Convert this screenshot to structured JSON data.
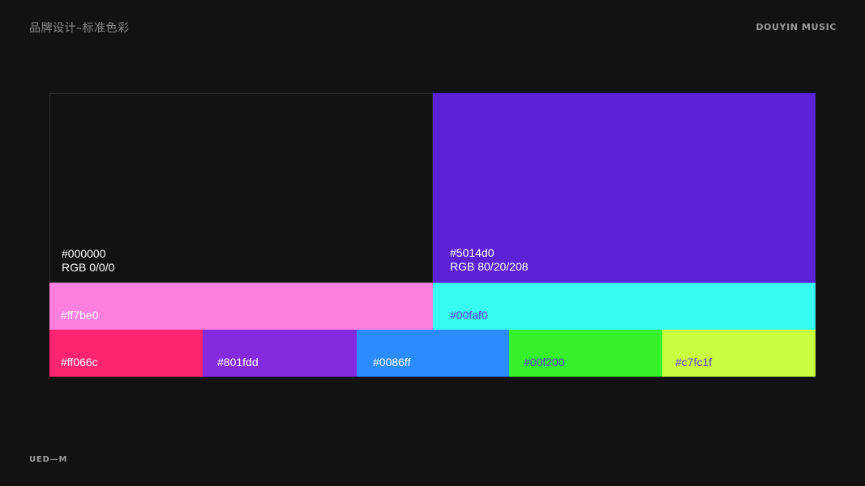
{
  "header": {
    "title": "品牌设计–标准色彩",
    "brand": "DOUYIN MUSIC"
  },
  "footer": {
    "mark": "UED—M"
  },
  "palette": {
    "primary": [
      {
        "hex_label": "#000000",
        "rgb_label": "RGB 0/0/0",
        "color": "#121212",
        "text_color": "#ffffff"
      },
      {
        "hex_label": "#5014d0",
        "rgb_label": "RGB 80/20/208",
        "color": "#5b22d6",
        "text_color": "#ffffff"
      }
    ],
    "secondary": [
      {
        "hex_label": "#ff7be0",
        "color": "#ff7fde",
        "text_color": "#ffffff"
      },
      {
        "hex_label": "#00faf0",
        "color": "#37fbf0",
        "text_color": "#5a3ad8"
      }
    ],
    "accents": [
      {
        "hex_label": "#ff066c",
        "color": "#ff2470",
        "text_color": "#ffffff"
      },
      {
        "hex_label": "#801fdd",
        "color": "#852bdf",
        "text_color": "#ffffff"
      },
      {
        "hex_label": "#0086ff",
        "color": "#2b8bff",
        "text_color": "#ffffff"
      },
      {
        "hex_label": "#00f200",
        "color": "#35f02a",
        "text_color": "#5a3ad8"
      },
      {
        "hex_label": "#c7fc1f",
        "color": "#c9fd3f",
        "text_color": "#5a3ad8"
      }
    ]
  }
}
